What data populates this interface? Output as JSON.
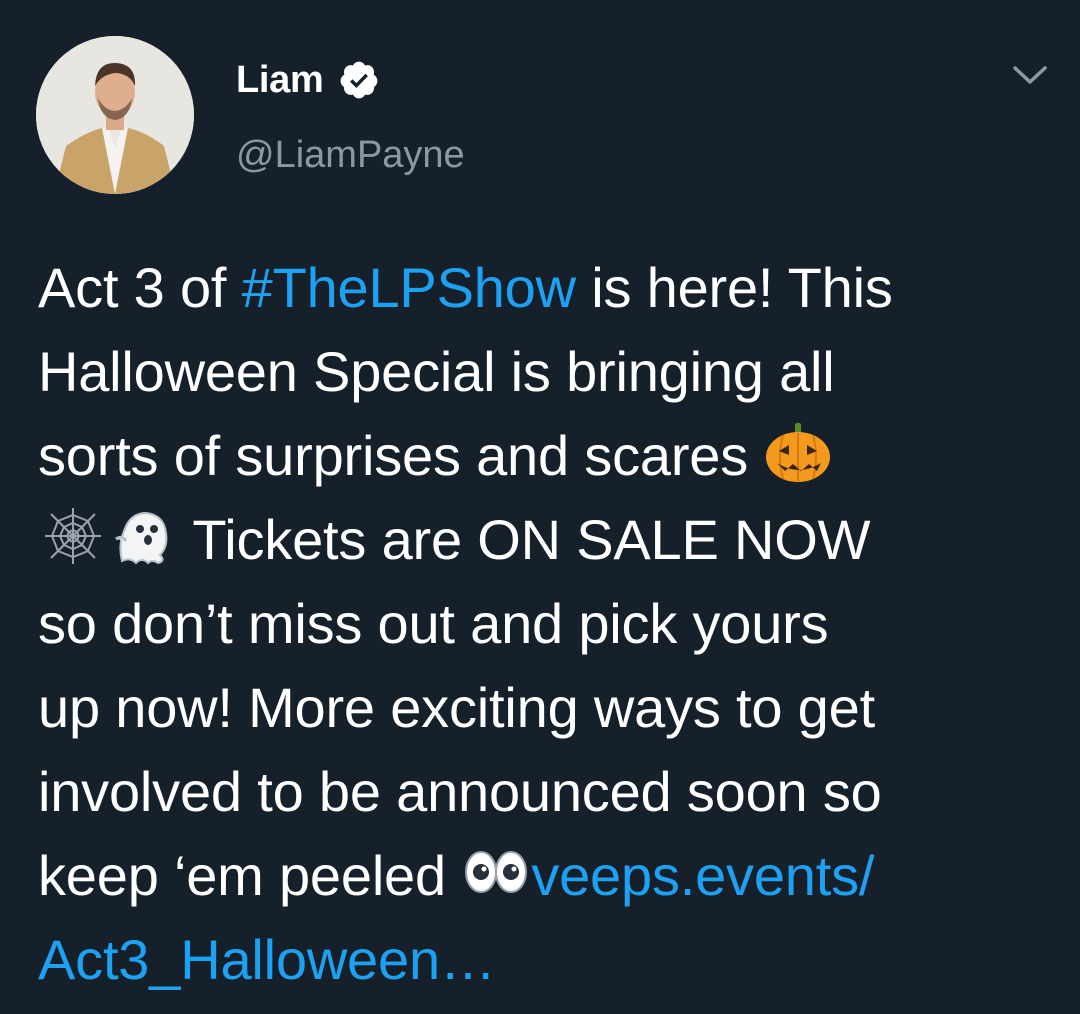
{
  "author": {
    "display_name": "Liam",
    "handle": "@LiamPayne",
    "verified_icon": "verified-badge-icon",
    "avatar_icon": "profile-avatar"
  },
  "menu": {
    "icon": "chevron-down-icon"
  },
  "tweet": {
    "l1_a": "Act 3 of ",
    "hashtag": "#TheLPShow",
    "l1_b": " is here! This",
    "l2": "Halloween Special is bringing all",
    "l3": "sorts of surprises and scares ",
    "l4_b": " Tickets are ON SALE NOW",
    "l5": "so don’t miss out and pick yours",
    "l6": "up now! More exciting ways to get",
    "l7": "involved to be announced soon so",
    "l8_a": "keep ‘em peeled ",
    "link_part1": "veeps.events/",
    "link_part2": "Act3_Halloween…",
    "emojis": [
      "jack-o-lantern-icon",
      "spider-web-icon",
      "ghost-icon",
      "eyes-icon"
    ]
  },
  "colors": {
    "background": "#15202b",
    "text": "#ffffff",
    "secondary": "#8899a6",
    "link": "#1da1f2"
  }
}
